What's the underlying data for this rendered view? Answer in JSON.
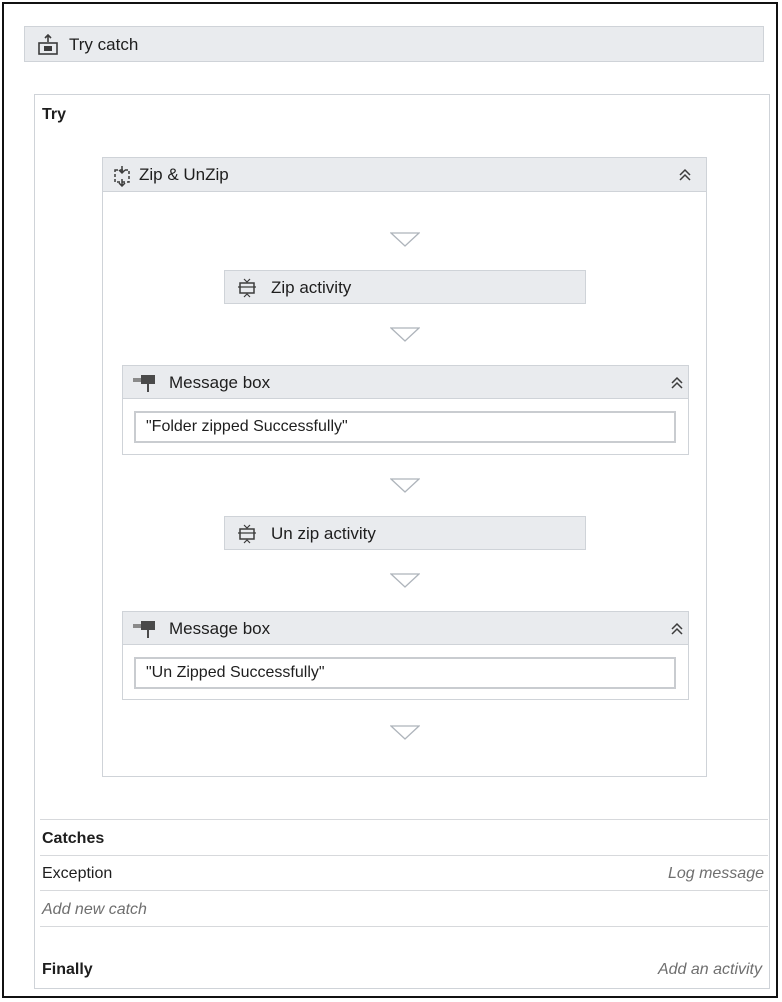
{
  "try_catch": {
    "title": "Try catch",
    "icon": "try-catch-icon",
    "try_label": "Try",
    "sequence": {
      "title": "Zip & UnZip",
      "icon": "sequence-icon",
      "collapse_icon": "double-chevron-up-icon",
      "activities": [
        {
          "type": "activity",
          "title": "Zip activity",
          "icon": "activity-icon"
        },
        {
          "type": "message_box",
          "title": "Message box",
          "icon": "message-box-icon",
          "value": "\"Folder zipped Successfully\""
        },
        {
          "type": "activity",
          "title": "Un zip activity",
          "icon": "activity-icon"
        },
        {
          "type": "message_box",
          "title": "Message box",
          "icon": "message-box-icon",
          "value": "\"Un Zipped Successfully\""
        }
      ]
    },
    "catches": {
      "label": "Catches",
      "rows": [
        {
          "exception": "Exception",
          "action": "Log message"
        }
      ],
      "add_label": "Add new catch"
    },
    "finally": {
      "label": "Finally",
      "action": "Add an activity"
    }
  },
  "colors": {
    "header_bg": "#e9ebee",
    "border": "#cfd3d8",
    "arrow": "#aeb4bb",
    "frame": "#111111"
  }
}
